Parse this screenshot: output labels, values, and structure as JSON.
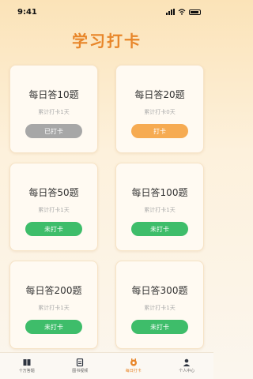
{
  "status_bar": {
    "time": "9:41"
  },
  "page": {
    "title": "学习打卡"
  },
  "cards": [
    {
      "title": "每日答10题",
      "sub": "累计打卡1天",
      "button": "已打卡",
      "color": "#a7a7a7"
    },
    {
      "title": "每日答20题",
      "sub": "累计打卡0天",
      "button": "打卡",
      "color": "#f6ab52"
    },
    {
      "title": "每日答50题",
      "sub": "累计打卡1天",
      "button": "未打卡",
      "color": "#3ebd6a"
    },
    {
      "title": "每日答100题",
      "sub": "累计打卡1天",
      "button": "未打卡",
      "color": "#3ebd6a"
    },
    {
      "title": "每日答200题",
      "sub": "累计打卡1天",
      "button": "未打卡",
      "color": "#3ebd6a"
    },
    {
      "title": "每日答300题",
      "sub": "累计打卡1天",
      "button": "未打卡",
      "color": "#3ebd6a"
    }
  ],
  "tabs": [
    {
      "label": "十万答题",
      "icon": "book-icon"
    },
    {
      "label": "图书视频",
      "icon": "document-icon"
    },
    {
      "label": "每日打卡",
      "icon": "checkin-icon"
    },
    {
      "label": "个人中心",
      "icon": "user-icon"
    }
  ],
  "colors": {
    "accent": "#e8862a"
  }
}
